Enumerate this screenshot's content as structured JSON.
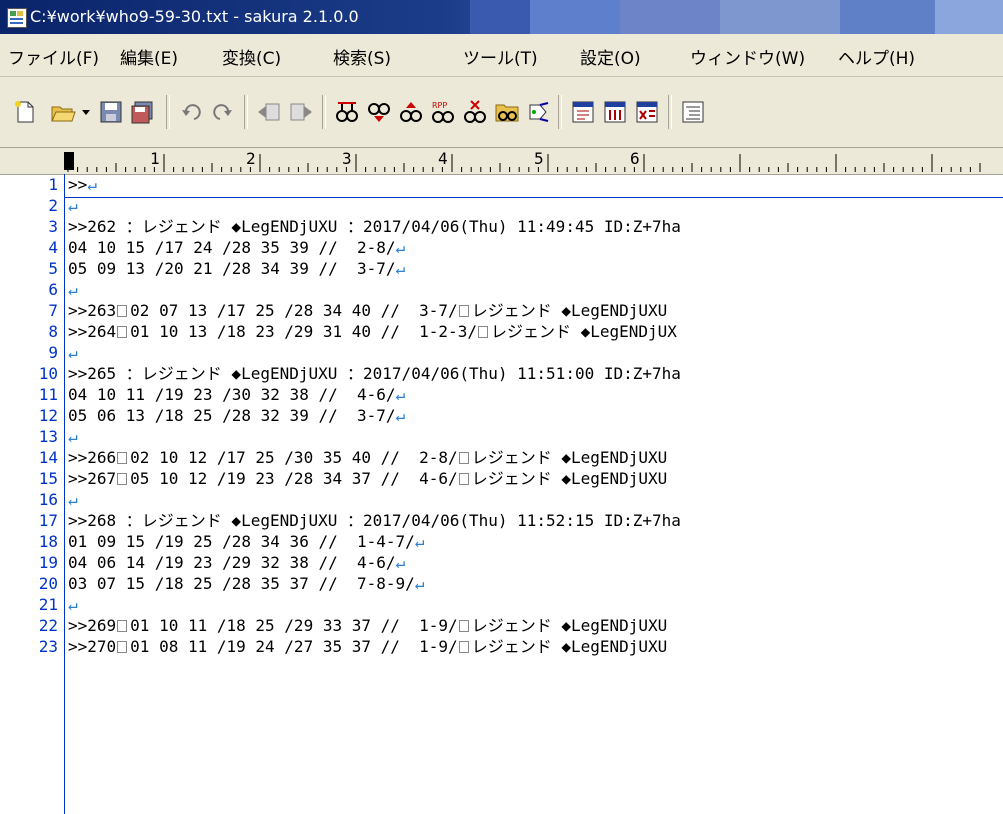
{
  "window": {
    "title": "C:¥work¥who9-59-30.txt - sakura 2.1.0.0",
    "colors": {
      "title_bar": "#0a246a",
      "line_number": "#0033cc",
      "crlf_mark": "#2a7fd4"
    }
  },
  "menu": {
    "items": [
      "ファイル(F)",
      "編集(E)",
      "変換(C)",
      "検索(S)",
      "ツール(T)",
      "設定(O)",
      "ウィンドウ(W)",
      "ヘルプ(H)"
    ]
  },
  "toolbar": {
    "icons": [
      "new-file-icon",
      "open-file-icon",
      "dropdown-arrow-icon",
      "save-icon",
      "save-all-icon",
      "undo-icon",
      "redo-icon",
      "prev-jump-icon",
      "next-jump-icon",
      "search-icon",
      "search-next-icon",
      "search-prev-icon",
      "replace-icon",
      "mark-icon",
      "grep-icon",
      "tag-jump-icon",
      "window-icon",
      "window2-icon",
      "window3-icon",
      "outline-icon"
    ]
  },
  "ruler": {
    "labels": [
      "1",
      "2",
      "3",
      "4",
      "5",
      "6"
    ]
  },
  "editor": {
    "crlf_mark": "↵",
    "lines": [
      {
        "n": "1",
        "t": ">>",
        "cr": true,
        "box": false
      },
      {
        "n": "2",
        "t": "",
        "cr": true,
        "box": false
      },
      {
        "n": "3",
        "t": ">>262 ：レジェンド ◆LegENDjUXU ：2017/04/06(Thu) 11:49:45 ID:Z+7ha",
        "cr": false,
        "box": false
      },
      {
        "n": "4",
        "t": "04 10 15 /17 24 /28 35 39 //  2-8/",
        "cr": true,
        "box": false
      },
      {
        "n": "5",
        "t": "05 09 13 /20 21 /28 34 39 //  3-7/",
        "cr": true,
        "box": false
      },
      {
        "n": "6",
        "t": "",
        "cr": true,
        "box": false
      },
      {
        "n": "7",
        "a": ">>263",
        "b": "02 07 13 /17 25 /28 34 40 //  3-7/",
        "c": "レジェンド ◆LegENDjUXU",
        "box": true
      },
      {
        "n": "8",
        "a": ">>264",
        "b": "01 10 13 /18 23 /29 31 40 //  1-2-3/",
        "c": "レジェンド ◆LegENDjUX",
        "box": true
      },
      {
        "n": "9",
        "t": "",
        "cr": true,
        "box": false
      },
      {
        "n": "10",
        "t": ">>265 ：レジェンド ◆LegENDjUXU ：2017/04/06(Thu) 11:51:00 ID:Z+7ha",
        "cr": false,
        "box": false
      },
      {
        "n": "11",
        "t": "04 10 11 /19 23 /30 32 38 //  4-6/",
        "cr": true,
        "box": false
      },
      {
        "n": "12",
        "t": "05 06 13 /18 25 /28 32 39 //  3-7/",
        "cr": true,
        "box": false
      },
      {
        "n": "13",
        "t": "",
        "cr": true,
        "box": false
      },
      {
        "n": "14",
        "a": ">>266",
        "b": "02 10 12 /17 25 /30 35 40 //  2-8/",
        "c": "レジェンド ◆LegENDjUXU",
        "box": true
      },
      {
        "n": "15",
        "a": ">>267",
        "b": "05 10 12 /19 23 /28 34 37 //  4-6/",
        "c": "レジェンド ◆LegENDjUXU",
        "box": true
      },
      {
        "n": "16",
        "t": "",
        "cr": true,
        "box": false
      },
      {
        "n": "17",
        "t": ">>268 ：レジェンド ◆LegENDjUXU ：2017/04/06(Thu) 11:52:15 ID:Z+7ha",
        "cr": false,
        "box": false
      },
      {
        "n": "18",
        "t": "01 09 15 /19 25 /28 34 36 //  1-4-7/",
        "cr": true,
        "box": false
      },
      {
        "n": "19",
        "t": "04 06 14 /19 23 /29 32 38 //  4-6/",
        "cr": true,
        "box": false
      },
      {
        "n": "20",
        "t": "03 07 15 /18 25 /28 35 37 //  7-8-9/",
        "cr": true,
        "box": false
      },
      {
        "n": "21",
        "t": "",
        "cr": true,
        "box": false
      },
      {
        "n": "22",
        "a": ">>269",
        "b": "01 10 11 /18 25 /29 33 37 //  1-9/",
        "c": "レジェンド ◆LegENDjUXU",
        "box": true
      },
      {
        "n": "23",
        "a": ">>270",
        "b": "01 08 11 /19 24 /27 35 37 //  1-9/",
        "c": "レジェンド ◆LegENDjUXU",
        "box": true
      }
    ]
  }
}
